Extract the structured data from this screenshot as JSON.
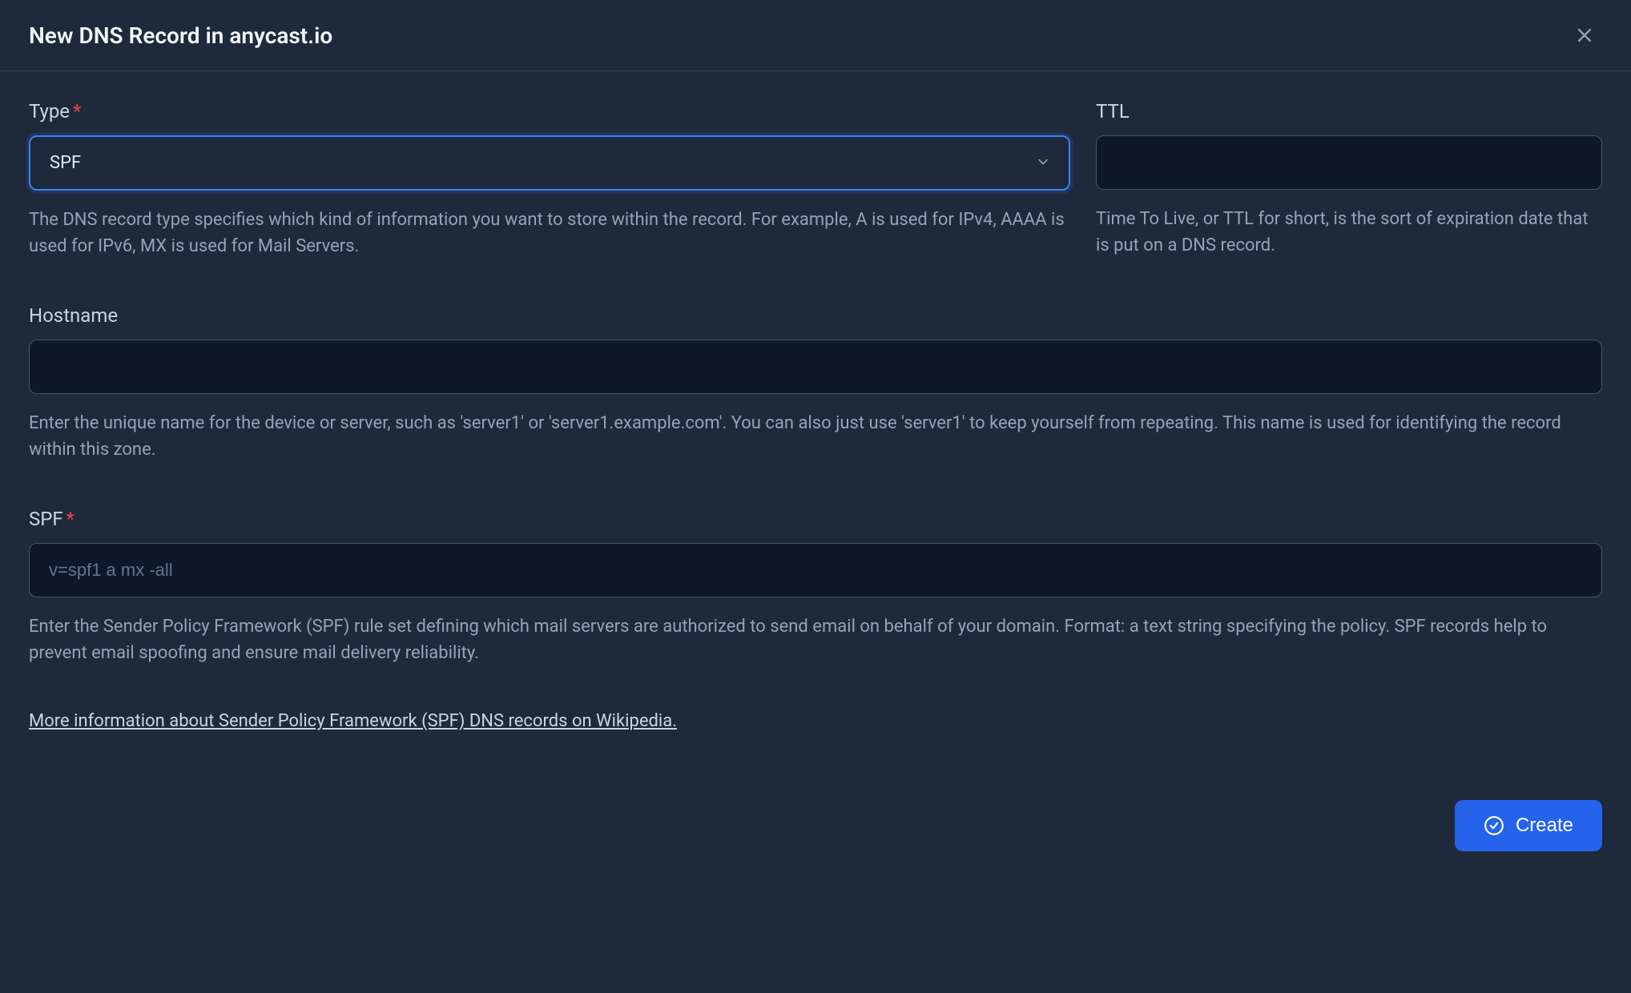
{
  "header": {
    "title": "New DNS Record in anycast.io"
  },
  "fields": {
    "type": {
      "label": "Type",
      "value": "SPF",
      "help": "The DNS record type specifies which kind of information you want to store within the record. For example, A is used for IPv4, AAAA is used for IPv6, MX is used for Mail Servers."
    },
    "ttl": {
      "label": "TTL",
      "value": "",
      "help": "Time To Live, or TTL for short, is the sort of expiration date that is put on a DNS record."
    },
    "hostname": {
      "label": "Hostname",
      "value": "",
      "help": "Enter the unique name for the device or server, such as 'server1' or 'server1.example.com'. You can also just use 'server1' to keep yourself from repeating. This name is used for identifying the record within this zone."
    },
    "spf": {
      "label": "SPF",
      "placeholder": "v=spf1 a mx -all",
      "value": "",
      "help": "Enter the Sender Policy Framework (SPF) rule set defining which mail servers are authorized to send email on behalf of your domain. Format: a text string specifying the policy. SPF records help to prevent email spoofing and ensure mail delivery reliability."
    }
  },
  "link": {
    "text": "More information about Sender Policy Framework (SPF) DNS records on Wikipedia."
  },
  "footer": {
    "create_label": "Create"
  }
}
